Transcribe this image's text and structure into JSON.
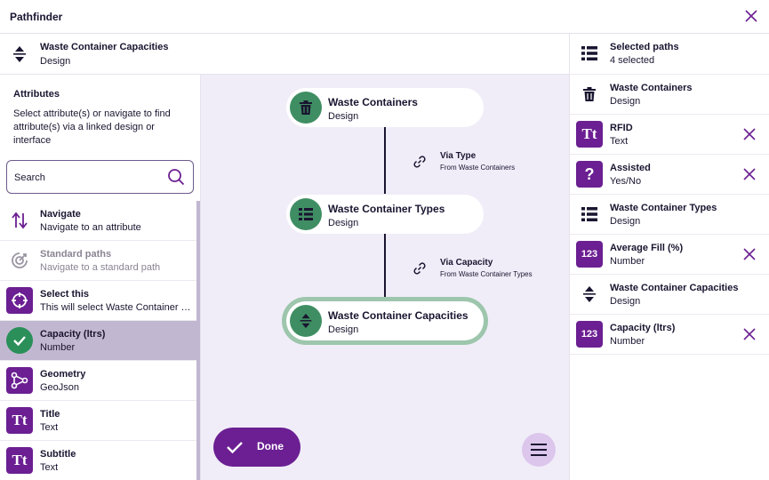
{
  "window": {
    "title": "Pathfinder"
  },
  "context": {
    "title": "Waste Container Capacities",
    "subtitle": "Design",
    "icon": "sort-arrows-icon"
  },
  "attributes": {
    "heading": "Attributes",
    "description": "Select attribute(s) or navigate to find attribute(s) via a linked design or interface",
    "search_placeholder": "Search",
    "items": [
      {
        "label": "Navigate",
        "sub": "Navigate to an attribute",
        "icon": "navigate-arrows-icon"
      },
      {
        "label": "Standard paths",
        "sub": "Navigate to a standard path",
        "icon": "target-icon"
      },
      {
        "label": "Select this",
        "sub": "This will select Waste Container Capacities",
        "icon": "crosshair-icon"
      },
      {
        "label": "Capacity (ltrs)",
        "sub": "Number",
        "icon": "check-icon"
      },
      {
        "label": "Geometry",
        "sub": "GeoJson",
        "icon": "geometry-icon"
      },
      {
        "label": "Title",
        "sub": "Text",
        "icon": "text-type-icon"
      },
      {
        "label": "Subtitle",
        "sub": "Text",
        "icon": "text-type-icon"
      }
    ]
  },
  "canvas": {
    "nodes": [
      {
        "title": "Waste Containers",
        "sub": "Design",
        "icon": "trash-icon"
      },
      {
        "title": "Waste Container Types",
        "sub": "Design",
        "icon": "list-icon"
      },
      {
        "title": "Waste Container Capacities",
        "sub": "Design",
        "icon": "sort-arrows-icon"
      }
    ],
    "links": [
      {
        "label": "Via Type",
        "from": "From Waste Containers",
        "icon": "link-icon"
      },
      {
        "label": "Via Capacity",
        "from": "From Waste Container Types",
        "icon": "link-icon"
      }
    ],
    "done_label": "Done"
  },
  "selected": {
    "title": "Selected paths",
    "count": "4 selected",
    "items": [
      {
        "label": "Waste Containers",
        "sub": "Design",
        "icon": "trash-icon",
        "removable": false
      },
      {
        "label": "RFID",
        "sub": "Text",
        "icon": "text-type-icon",
        "removable": true
      },
      {
        "label": "Assisted",
        "sub": "Yes/No",
        "icon": "question-icon",
        "removable": true
      },
      {
        "label": "Waste Container Types",
        "sub": "Design",
        "icon": "list-icon",
        "removable": false
      },
      {
        "label": "Average Fill (%)",
        "sub": "Number",
        "icon": "number-123-icon",
        "removable": true
      },
      {
        "label": "Waste Container Capacities",
        "sub": "Design",
        "icon": "sort-arrows-icon",
        "removable": false
      },
      {
        "label": "Capacity (ltrs)",
        "sub": "Number",
        "icon": "number-123-icon",
        "removable": true
      }
    ]
  },
  "colors": {
    "accent": "#6b1f92",
    "success": "#2a8f59",
    "node_green": "#3f8e63",
    "canvas_bg": "#f0edf8",
    "selected_row": "#c2b7d1"
  },
  "glyphs": {
    "tt": "Tt",
    "num": "123",
    "q": "?"
  }
}
